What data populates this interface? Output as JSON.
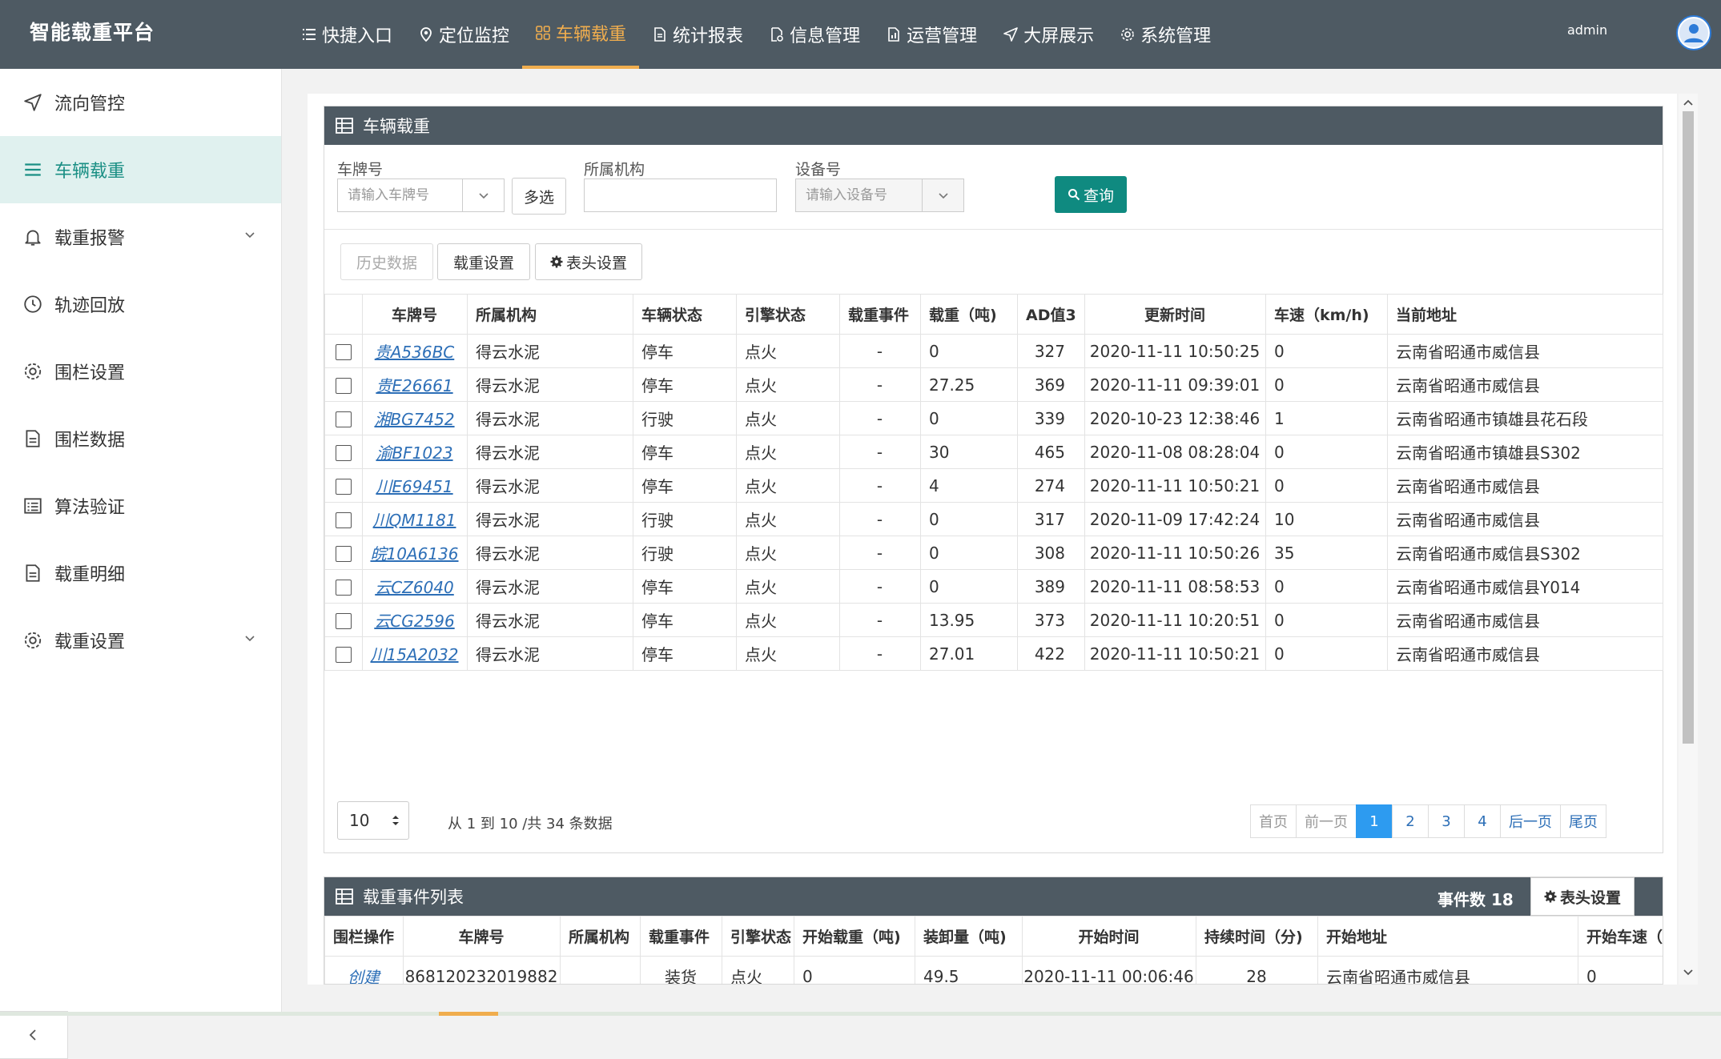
{
  "app": {
    "title": "智能载重平台",
    "user": "admin"
  },
  "nav": [
    {
      "label": "快捷入口",
      "icon": "list-icon"
    },
    {
      "label": "定位监控",
      "icon": "location-pin-icon"
    },
    {
      "label": "车辆载重",
      "icon": "grid-icon",
      "active": true
    },
    {
      "label": "统计报表",
      "icon": "document-icon"
    },
    {
      "label": "信息管理",
      "icon": "document-gear-icon"
    },
    {
      "label": "运营管理",
      "icon": "document-chart-icon"
    },
    {
      "label": "大屏展示",
      "icon": "send-icon"
    },
    {
      "label": "系统管理",
      "icon": "gear-icon"
    }
  ],
  "sidebar": [
    {
      "label": "流向管控",
      "icon": "send-icon"
    },
    {
      "label": "车辆载重",
      "icon": "menu-icon",
      "active": true
    },
    {
      "label": "载重报警",
      "icon": "bell-icon",
      "expandable": true
    },
    {
      "label": "轨迹回放",
      "icon": "clock-icon"
    },
    {
      "label": "围栏设置",
      "icon": "gear-icon"
    },
    {
      "label": "围栏数据",
      "icon": "document-icon"
    },
    {
      "label": "算法验证",
      "icon": "list-box-icon"
    },
    {
      "label": "载重明细",
      "icon": "document-icon"
    },
    {
      "label": "载重设置",
      "icon": "gear-icon",
      "expandable": true
    }
  ],
  "panel1": {
    "title": "车辆载重",
    "filters": {
      "plate_label": "车牌号",
      "plate_placeholder": "请输入车牌号",
      "multi_label": "多选",
      "org_label": "所属机构",
      "org_value": "",
      "device_label": "设备号",
      "device_placeholder": "请输入设备号",
      "query_label": "查询"
    },
    "actions": {
      "history": "历史数据",
      "load_settings": "载重设置",
      "header_settings": "表头设置"
    },
    "columns": [
      "车牌号",
      "所属机构",
      "车辆状态",
      "引擎状态",
      "载重事件",
      "载重（吨)",
      "AD值3",
      "更新时间",
      "车速（km/h)",
      "当前地址"
    ],
    "rows": [
      [
        "贵A536BC",
        "得云水泥",
        "停车",
        "点火",
        "-",
        "0",
        "327",
        "2020-11-11 10:50:25",
        "0",
        "云南省昭通市威信县"
      ],
      [
        "贵E26661",
        "得云水泥",
        "停车",
        "点火",
        "-",
        "27.25",
        "369",
        "2020-11-11 09:39:01",
        "0",
        "云南省昭通市威信县"
      ],
      [
        "湘BG7452",
        "得云水泥",
        "行驶",
        "点火",
        "-",
        "0",
        "339",
        "2020-10-23 12:38:46",
        "1",
        "云南省昭通市镇雄县花石段"
      ],
      [
        "渝BF1023",
        "得云水泥",
        "停车",
        "点火",
        "-",
        "30",
        "465",
        "2020-11-08 08:28:04",
        "0",
        "云南省昭通市镇雄县S302"
      ],
      [
        "川E69451",
        "得云水泥",
        "停车",
        "点火",
        "-",
        "4",
        "274",
        "2020-11-11 10:50:21",
        "0",
        "云南省昭通市威信县"
      ],
      [
        "川QM1181",
        "得云水泥",
        "行驶",
        "点火",
        "-",
        "0",
        "317",
        "2020-11-09 17:42:24",
        "10",
        "云南省昭通市威信县"
      ],
      [
        "皖10A6136",
        "得云水泥",
        "行驶",
        "点火",
        "-",
        "0",
        "308",
        "2020-11-11 10:50:26",
        "35",
        "云南省昭通市威信县S302"
      ],
      [
        "云CZ6040",
        "得云水泥",
        "停车",
        "点火",
        "-",
        "0",
        "389",
        "2020-11-11 08:58:53",
        "0",
        "云南省昭通市威信县Y014"
      ],
      [
        "云CG2596",
        "得云水泥",
        "停车",
        "点火",
        "-",
        "13.95",
        "373",
        "2020-11-11 10:20:51",
        "0",
        "云南省昭通市威信县"
      ],
      [
        "川15A2032",
        "得云水泥",
        "停车",
        "点火",
        "-",
        "27.01",
        "422",
        "2020-11-11 10:50:21",
        "0",
        "云南省昭通市威信县"
      ]
    ],
    "page_size": "10",
    "page_info": "从 1 到 10 /共 34 条数据",
    "pager": [
      "首页",
      "前一页",
      "1",
      "2",
      "3",
      "4",
      "后一页",
      "尾页"
    ]
  },
  "panel2": {
    "title": "载重事件列表",
    "event_count": "事件数 18",
    "header_settings": "表头设置",
    "columns": [
      "围栏操作",
      "车牌号",
      "所属机构",
      "载重事件",
      "引擎状态",
      "开始载重（吨)",
      "装卸量（吨)",
      "开始时间",
      "持续时间（分)",
      "开始地址",
      "开始车速（"
    ],
    "rows": [
      [
        "创建",
        "868120232019882",
        "",
        "装货",
        "点火",
        "0",
        "49.5",
        "2020-11-11 00:06:46",
        "28",
        "云南省昭通市威信县",
        "0"
      ]
    ]
  },
  "colors": {
    "topbar": "#4e5a63",
    "active_nav": "#f0ad4e",
    "accent": "#0f8a80",
    "link": "#2d6fb7",
    "pager_active": "#2d9bf0"
  }
}
